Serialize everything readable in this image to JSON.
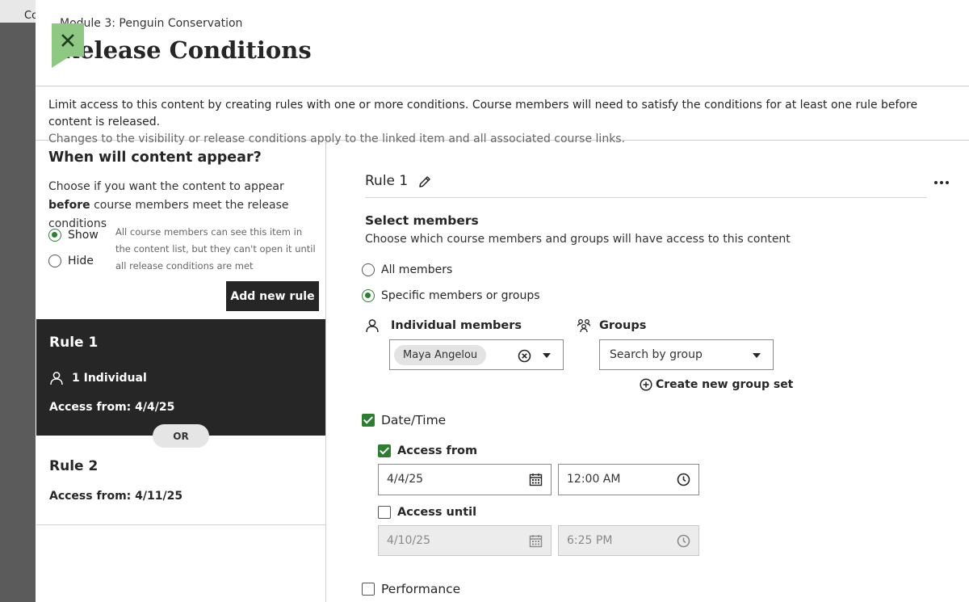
{
  "background": {
    "partial_text": "Co"
  },
  "header": {
    "breadcrumb": "Module 3: Penguin Conservation",
    "title": "Release Conditions"
  },
  "intro": {
    "line1": "Limit access to this content by creating rules with one or more conditions. Course members will need to satisfy the conditions for at least one rule before content is released.",
    "line2": "Changes to the visibility or release conditions apply to the linked item and all associated course links."
  },
  "visibility": {
    "heading": "When will content appear?",
    "desc_before": "Choose if you want the content to appear ",
    "desc_bold": "before",
    "desc_after": " course members meet the release conditions",
    "show_label": "Show",
    "hide_label": "Hide",
    "selected": "Show",
    "note": "All course members can see this item in the content list, but they can't open it until all release conditions are met"
  },
  "add_rule_label": "Add new rule",
  "rules_list": [
    {
      "title": "Rule 1",
      "members": "1 Individual",
      "access": "Access from: 4/4/25",
      "active": true
    },
    {
      "title": "Rule 2",
      "access": "Access from: 4/11/25",
      "active": false
    }
  ],
  "or_label": "OR",
  "rule_detail": {
    "name": "Rule 1",
    "select_members_title": "Select members",
    "select_members_desc": "Choose which course members and groups will have access to this content",
    "all_members_label": "All members",
    "specific_label": "Specific members or groups",
    "selected_option": "Specific members or groups",
    "individual_label": "Individual members",
    "groups_label": "Groups",
    "selected_member": "Maya Angelou",
    "group_placeholder": "Search by group",
    "create_group_label": "Create new group set",
    "datetime_label": "Date/Time",
    "datetime_checked": true,
    "access_from_label": "Access from",
    "access_from_checked": true,
    "access_from_date": "4/4/25",
    "access_from_time": "12:00 AM",
    "access_until_label": "Access until",
    "access_until_checked": false,
    "access_until_date": "4/10/25",
    "access_until_time": "6:25 PM",
    "performance_label": "Performance",
    "performance_checked": false
  },
  "colors": {
    "accent_green": "#2e7d32",
    "close_button": "#8fc882",
    "active_rule_bg": "#262626"
  },
  "icons": [
    "close-icon",
    "pencil-icon",
    "more-icon",
    "person-icon",
    "group-icon",
    "clear-icon",
    "chevron-down-icon",
    "plus-circle-icon",
    "calendar-icon",
    "clock-icon"
  ]
}
